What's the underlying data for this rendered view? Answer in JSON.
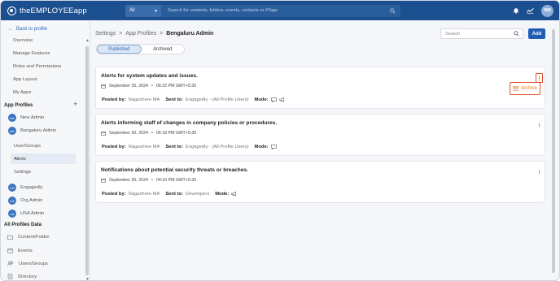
{
  "app": {
    "logo_text": "theEMPLOYEEapp",
    "avatar_initials": "NM"
  },
  "top_search": {
    "scope": "All",
    "placeholder": "Search for contents, folders, events, contacts or #Tags"
  },
  "sidebar": {
    "back_label": "Back to profile",
    "items": [
      "Overview",
      "Manage Features",
      "Roles and Permissions",
      "App Layout",
      "My Apps"
    ],
    "app_profiles_title": "App Profiles",
    "profiles": [
      {
        "name": "New Admin",
        "initials": "NA"
      },
      {
        "name": "Bengaluru Admin",
        "initials": "BA"
      }
    ],
    "sub_items": [
      "User/Groups",
      "Alerts",
      "Settings"
    ],
    "active_sub": "Alerts",
    "other_profiles": [
      {
        "name": "Engagedly",
        "initials": "EN"
      },
      {
        "name": "Org Admin",
        "initials": "OA"
      },
      {
        "name": "USA Admin",
        "initials": "UA"
      }
    ],
    "all_profiles_title": "All Profiles Data",
    "data_items": [
      "Content/Folder",
      "Events",
      "Users/Groups",
      "Directory"
    ]
  },
  "breadcrumb": {
    "items": [
      "Settings",
      "App Profiles",
      "Bengaluru Admin"
    ],
    "separator": ">"
  },
  "main_search": {
    "placeholder": "Search"
  },
  "add_label": "Add",
  "tabs": [
    {
      "label": "Published",
      "active": true
    },
    {
      "label": "Archived",
      "active": false
    }
  ],
  "labels": {
    "posted_by": "Posted by:",
    "sent_to": "Sent to:",
    "mode": "Mode:"
  },
  "alerts": [
    {
      "title": "Alerts for system updates and issues.",
      "date": "September 30, 2024",
      "time": "06:22 PM GMT+5:30",
      "posted_by": "Nagashree MA",
      "sent_to": "Engagedly - (All Profile Users)",
      "modes": [
        "chat",
        "announce"
      ]
    },
    {
      "title": "Alerts informing staff of changes in company policies or procedures.",
      "date": "September 30, 2024",
      "time": "06:18 PM GMT+5:30",
      "posted_by": "Nagashree MA",
      "sent_to": "Engagedly - (All Profile Users)",
      "modes": [
        "chat"
      ]
    },
    {
      "title": "Notifications about potential security threats or breaches.",
      "date": "September 30, 2024",
      "time": "04:10 PM GMT+5:30",
      "posted_by": "Nagashree MA",
      "sent_to": "Developers",
      "modes": [
        "announce"
      ]
    }
  ],
  "context_menu": {
    "archive_label": "Archive"
  },
  "colors": {
    "brand": "#1c4f8f",
    "accent": "#1f5fb3",
    "highlight": "#e0522a"
  }
}
